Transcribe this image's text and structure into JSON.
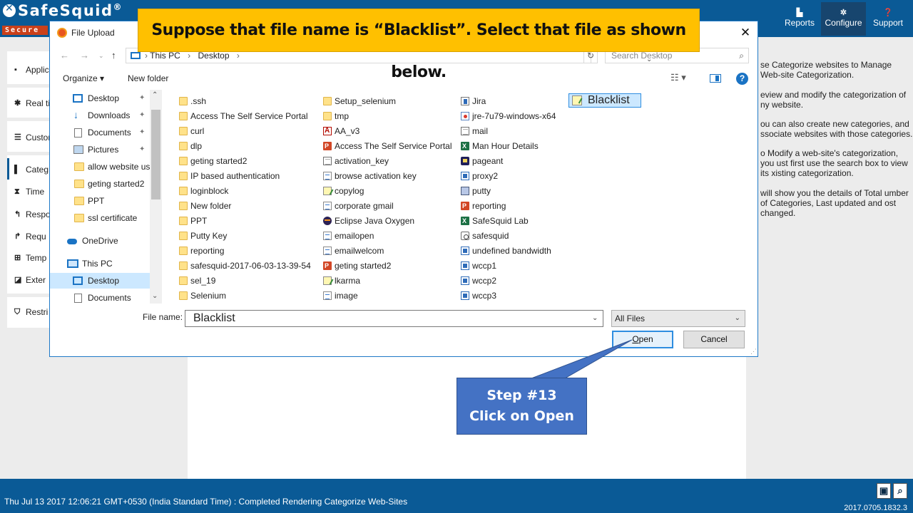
{
  "app": {
    "logo_text": "SafeSquid",
    "logo_registered": "®",
    "logo_sub": "Secure",
    "nav": [
      {
        "label": "Reports",
        "icon": "bar-chart-icon"
      },
      {
        "label": "Configure",
        "icon": "gears-icon"
      },
      {
        "label": "Support",
        "icon": "question-icon"
      }
    ],
    "sidebar": [
      {
        "label": "Applic",
        "icon": "briefcase-icon"
      },
      {
        "label": "Real ti",
        "icon": "pulse-icon"
      },
      {
        "label": "Custom",
        "icon": "sliders-icon"
      },
      {
        "label": "Categ",
        "icon": "book-icon"
      },
      {
        "label": "Time",
        "icon": "hourglass-icon"
      },
      {
        "label": "Respo",
        "icon": "reply-icon"
      },
      {
        "label": "Requ",
        "icon": "forward-icon"
      },
      {
        "label": "Temp",
        "icon": "sitemap-icon"
      },
      {
        "label": "Exter",
        "icon": "external-icon"
      },
      {
        "label": "Restri",
        "icon": "shield-icon"
      }
    ],
    "right_panel": [
      "se Categorize websites to Manage Web-site Categorization.",
      "eview and modify the categorization of ny website.",
      "ou can also create new categories, and ssociate websites with those categories.",
      "o Modify a web-site's categorization, you ust first use the search box to view its xisting categorization.",
      " will show you the details of Total umber of Categories, Last updated and ost changed."
    ],
    "status": "Thu Jul 13 2017 12:06:21 GMT+0530 (India Standard Time) : Completed Rendering Categorize Web-Sites",
    "version": "2017.0705.1832.3"
  },
  "dialog": {
    "title": "File Upload",
    "close": "✕",
    "address": {
      "segments": [
        "This PC",
        "Desktop"
      ],
      "separator": "›",
      "search_placeholder": "Search Desktop"
    },
    "toolbar": {
      "organize": "Organize ▾",
      "new_folder": "New folder",
      "help": "?"
    },
    "nav_pane": [
      {
        "label": "Desktop",
        "icon": "desktop-icon",
        "pinned": true
      },
      {
        "label": "Downloads",
        "icon": "download-icon",
        "pinned": true
      },
      {
        "label": "Documents",
        "icon": "documents-icon",
        "pinned": true
      },
      {
        "label": "Pictures",
        "icon": "pictures-icon",
        "pinned": true
      },
      {
        "label": "allow website us",
        "icon": "folder-icon"
      },
      {
        "label": "geting started2",
        "icon": "folder-icon"
      },
      {
        "label": "PPT",
        "icon": "folder-icon"
      },
      {
        "label": "ssl certificate",
        "icon": "folder-icon"
      },
      {
        "label": "OneDrive",
        "icon": "cloud-icon"
      },
      {
        "label": "This PC",
        "icon": "computer-icon"
      },
      {
        "label": "Desktop",
        "icon": "desktop-icon",
        "selected": true
      },
      {
        "label": "Documents",
        "icon": "documents-icon"
      }
    ],
    "files": {
      "col1": [
        ".ssh",
        "Access The Self Service Portal",
        "curl",
        "dlp",
        "geting started2",
        "IP based authentication",
        "loginblock",
        "New folder",
        "PPT",
        "Putty Key",
        "reporting",
        "safesquid-2017-06-03-13-39-54",
        "sel_19",
        "Selenium"
      ],
      "col2": [
        "Setup_selenium",
        "tmp",
        "AA_v3",
        "Access The Self Service Portal",
        "activation_key",
        "browse activation key",
        "copylog",
        "corporate gmail",
        "Eclipse Java Oxygen",
        "emailopen",
        "emailwelcom",
        "geting started2",
        "lkarma",
        "image"
      ],
      "col3": [
        "Jira",
        "jre-7u79-windows-x64",
        "mail",
        "Man Hour Details",
        "pageant",
        "proxy2",
        "putty",
        "reporting",
        "SafeSquid Lab",
        "safesquid",
        "undefined bandwidth",
        "wccp1",
        "wccp2",
        "wccp3"
      ],
      "col4": [
        "Blacklist"
      ]
    },
    "file_name_label": "File name:",
    "file_name_value": "Blacklist",
    "file_type": "All Files",
    "open_prefix": "",
    "open_underlined": "O",
    "open_rest": "pen",
    "cancel": "Cancel"
  },
  "tutorial": {
    "banner": "Suppose that file name is “Blacklist”. Select that file as shown below.",
    "step": "Step #13",
    "action": "Click on Open"
  }
}
